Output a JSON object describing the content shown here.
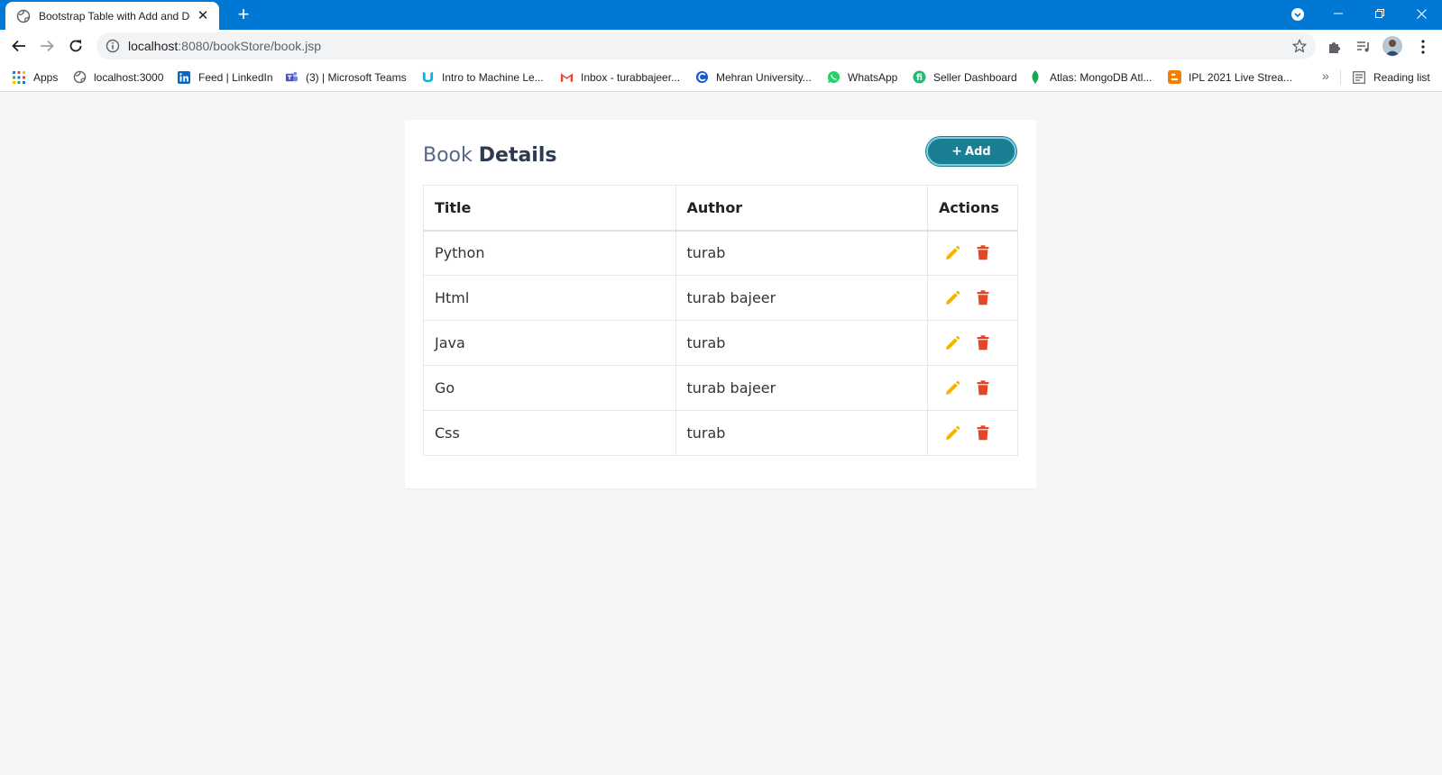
{
  "browser": {
    "tab": {
      "title": "Bootstrap Table with Add and Delete"
    },
    "address": {
      "host": "localhost",
      "rest": ":8080/bookStore/book.jsp"
    },
    "bookmarks": [
      {
        "label": "Apps",
        "icon": "apps-grid-icon"
      },
      {
        "label": "localhost:3000",
        "icon": "globe-icon"
      },
      {
        "label": "Feed | LinkedIn",
        "icon": "linkedin-icon"
      },
      {
        "label": "(3) | Microsoft Teams",
        "icon": "teams-icon"
      },
      {
        "label": "Intro to Machine Le...",
        "icon": "udacity-icon"
      },
      {
        "label": "Inbox - turabbajeer...",
        "icon": "gmail-icon"
      },
      {
        "label": "Mehran University...",
        "icon": "university-icon"
      },
      {
        "label": "WhatsApp",
        "icon": "whatsapp-icon"
      },
      {
        "label": "Seller Dashboard",
        "icon": "fiverr-icon"
      },
      {
        "label": "Atlas: MongoDB Atl...",
        "icon": "mongodb-leaf-icon"
      },
      {
        "label": "IPL 2021 Live Strea...",
        "icon": "blogger-icon"
      }
    ],
    "more_bookmarks": "»",
    "reading_list": "Reading list"
  },
  "page": {
    "title_light": "Book",
    "title_bold": "Details",
    "add_button": {
      "icon": "+",
      "label": "Add"
    },
    "table": {
      "headers": [
        "Title",
        "Author",
        "Actions"
      ],
      "rows": [
        {
          "title": "Python",
          "author": "turab"
        },
        {
          "title": "Html",
          "author": "turab bajeer"
        },
        {
          "title": "Java",
          "author": "turab"
        },
        {
          "title": "Go",
          "author": "turab bajeer"
        },
        {
          "title": "Css",
          "author": "turab"
        }
      ]
    }
  },
  "colors": {
    "browser_accent": "#0078d4",
    "add_button": "#1a7f93",
    "edit_icon": "#f5b301",
    "delete_icon": "#e34724"
  }
}
